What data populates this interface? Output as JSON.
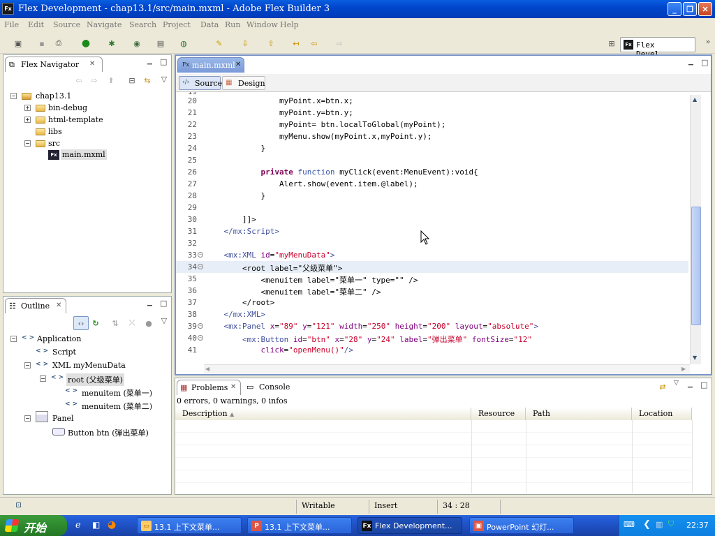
{
  "window": {
    "title": "Flex Development - chap13.1/src/main.mxml - Adobe Flex Builder 3",
    "app_icon": "Fx"
  },
  "menu": [
    "File",
    "Edit",
    "Source",
    "Navigate",
    "Search",
    "Project",
    "Data",
    "Run",
    "Window",
    "Help"
  ],
  "perspective": {
    "label": "Flex Devel...",
    "icon": "Fx"
  },
  "navigator": {
    "tab_label": "Flex Navigator",
    "tree": [
      {
        "label": "chap13.1",
        "depth": 0,
        "expander": "−"
      },
      {
        "label": "bin-debug",
        "depth": 1,
        "expander": "+"
      },
      {
        "label": "html-template",
        "depth": 1,
        "expander": "+"
      },
      {
        "label": "libs",
        "depth": 1,
        "expander": ""
      },
      {
        "label": "src",
        "depth": 1,
        "expander": "−"
      },
      {
        "label": "main.mxml",
        "depth": 2,
        "expander": ""
      }
    ]
  },
  "outline": {
    "tab_label": "Outline",
    "tree": [
      {
        "label": "Application",
        "depth": 0,
        "expander": "−"
      },
      {
        "label": "Script",
        "depth": 1,
        "expander": ""
      },
      {
        "label": "XML myMenuData",
        "depth": 1,
        "expander": "−"
      },
      {
        "label": "root (父级菜单)",
        "depth": 2,
        "expander": "−"
      },
      {
        "label": "menuitem (菜单一)",
        "depth": 3,
        "expander": ""
      },
      {
        "label": "menuitem (菜单二)",
        "depth": 3,
        "expander": ""
      },
      {
        "label": "Panel",
        "depth": 1,
        "expander": "−"
      },
      {
        "label": "Button btn (弹出菜单)",
        "depth": 2,
        "expander": ""
      }
    ]
  },
  "editor": {
    "tab_label": "main.mxml",
    "source_tab": "Source",
    "design_tab": "Design",
    "first_line_number": "19",
    "lines": [
      {
        "n": "20",
        "parts": [
          [
            "",
            "                myPoint.x=btn.x;"
          ]
        ]
      },
      {
        "n": "21",
        "parts": [
          [
            "",
            "                myPoint.y=btn.y;"
          ]
        ]
      },
      {
        "n": "22",
        "parts": [
          [
            "",
            "                myPoint= btn.localToGlobal(myPoint);"
          ]
        ]
      },
      {
        "n": "23",
        "parts": [
          [
            "",
            "                myMenu.show(myPoint.x,myPoint.y);"
          ]
        ]
      },
      {
        "n": "24",
        "parts": [
          [
            "",
            "            }"
          ]
        ]
      },
      {
        "n": "25",
        "parts": [
          [
            "",
            ""
          ]
        ]
      },
      {
        "n": "26",
        "parts": [
          [
            "",
            "            "
          ],
          [
            "k",
            "private"
          ],
          [
            "",
            " "
          ],
          [
            "k2",
            "function"
          ],
          [
            "",
            " myClick(event:MenuEvent):void{"
          ]
        ]
      },
      {
        "n": "27",
        "parts": [
          [
            "",
            "                Alert.show(event.item.@label);"
          ]
        ]
      },
      {
        "n": "28",
        "parts": [
          [
            "",
            "            }"
          ]
        ]
      },
      {
        "n": "29",
        "parts": [
          [
            "",
            ""
          ]
        ]
      },
      {
        "n": "30",
        "parts": [
          [
            "",
            "        ]]>"
          ]
        ]
      },
      {
        "n": "31",
        "parts": [
          [
            "",
            "    "
          ],
          [
            "tg",
            "</mx:Script>"
          ]
        ]
      },
      {
        "n": "32",
        "parts": [
          [
            "",
            ""
          ]
        ]
      },
      {
        "n": "33",
        "fold": "−",
        "parts": [
          [
            "",
            "    "
          ],
          [
            "tg",
            "<mx:XML"
          ],
          [
            "",
            " "
          ],
          [
            "at",
            "id"
          ],
          [
            "",
            "="
          ],
          [
            "s",
            "\"myMenuData\""
          ],
          [
            "tg",
            ">"
          ]
        ]
      },
      {
        "n": "34",
        "fold": "−",
        "current": true,
        "parts": [
          [
            "",
            "        <root label=\""
          ],
          [
            "",
            "父级菜单"
          ],
          [
            "",
            "\">"
          ]
        ]
      },
      {
        "n": "35",
        "parts": [
          [
            "",
            "            <menuitem label=\"菜单一\" type=\"\" />"
          ]
        ]
      },
      {
        "n": "36",
        "parts": [
          [
            "",
            "            <menuitem label=\"菜单二\" />"
          ]
        ]
      },
      {
        "n": "37",
        "parts": [
          [
            "",
            "        </root>"
          ]
        ]
      },
      {
        "n": "38",
        "parts": [
          [
            "",
            "    "
          ],
          [
            "tg",
            "</mx:XML>"
          ]
        ]
      },
      {
        "n": "39",
        "fold": "−",
        "parts": [
          [
            "",
            "    "
          ],
          [
            "tg",
            "<mx:Panel"
          ],
          [
            "",
            " "
          ],
          [
            "at",
            "x"
          ],
          [
            "",
            "="
          ],
          [
            "s",
            "\"89\""
          ],
          [
            "",
            " "
          ],
          [
            "at",
            "y"
          ],
          [
            "",
            "="
          ],
          [
            "s",
            "\"121\""
          ],
          [
            "",
            " "
          ],
          [
            "at",
            "width"
          ],
          [
            "",
            "="
          ],
          [
            "s",
            "\"250\""
          ],
          [
            "",
            " "
          ],
          [
            "at",
            "height"
          ],
          [
            "",
            "="
          ],
          [
            "s",
            "\"200\""
          ],
          [
            "",
            " "
          ],
          [
            "at",
            "layout"
          ],
          [
            "",
            "="
          ],
          [
            "s",
            "\"absolute\""
          ],
          [
            "tg",
            ">"
          ]
        ]
      },
      {
        "n": "40",
        "fold": "−",
        "parts": [
          [
            "",
            "        "
          ],
          [
            "tg",
            "<mx:Button"
          ],
          [
            "",
            " "
          ],
          [
            "at",
            "id"
          ],
          [
            "",
            "="
          ],
          [
            "s",
            "\"btn\""
          ],
          [
            "",
            " "
          ],
          [
            "at",
            "x"
          ],
          [
            "",
            "="
          ],
          [
            "s",
            "\"28\""
          ],
          [
            "",
            " "
          ],
          [
            "at",
            "y"
          ],
          [
            "",
            "="
          ],
          [
            "s",
            "\"24\""
          ],
          [
            "",
            " "
          ],
          [
            "at",
            "label"
          ],
          [
            "",
            "="
          ],
          [
            "s",
            "\"弹出菜单\""
          ],
          [
            "",
            " "
          ],
          [
            "at",
            "fontSize"
          ],
          [
            "",
            "="
          ],
          [
            "s",
            "\"12\""
          ]
        ]
      },
      {
        "n": "41",
        "parts": [
          [
            "",
            "            "
          ],
          [
            "at",
            "click"
          ],
          [
            "",
            "="
          ],
          [
            "s",
            "\"openMenu()\""
          ],
          [
            "tg",
            "/>"
          ]
        ]
      }
    ]
  },
  "problems": {
    "tab_label": "Problems",
    "console_label": "Console",
    "summary": "0 errors, 0 warnings, 0 infos",
    "columns": [
      "Description",
      "Resource",
      "Path",
      "Location"
    ]
  },
  "status": {
    "mode": "Writable",
    "insert": "Insert",
    "position": "34 : 28"
  },
  "taskbar": {
    "start_label": "开始",
    "items": [
      {
        "label": "13.1 上下文菜单...",
        "icon": "folder-icon"
      },
      {
        "label": "13.1 上下文菜单...",
        "icon": "powerpoint-icon"
      },
      {
        "label": "Flex Development...",
        "icon": "flex-icon",
        "active": true
      },
      {
        "label": "PowerPoint 幻灯...",
        "icon": "slideshow-icon"
      }
    ],
    "clock": "22:37"
  }
}
